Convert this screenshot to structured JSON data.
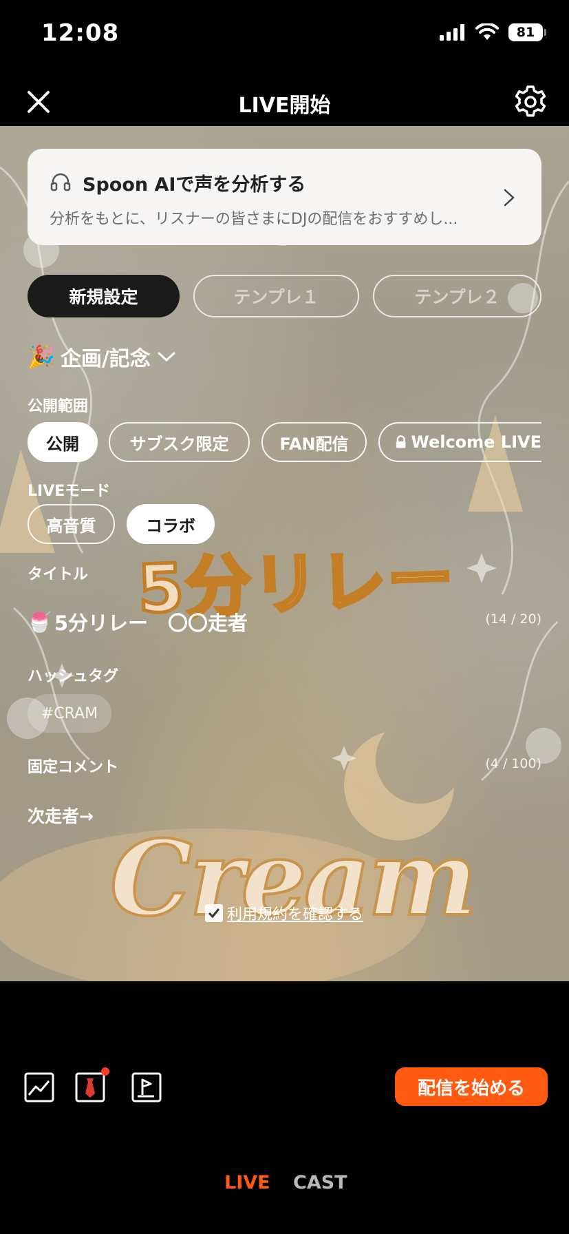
{
  "status_bar": {
    "time": "12:08",
    "battery": "81"
  },
  "header": {
    "title": "LIVE開始"
  },
  "ai_card": {
    "title": "Spoon AIで声を分析する",
    "description": "分析をもとに、リスナーの皆さまにDJの配信をおすすめし..."
  },
  "template_tabs": [
    "新規設定",
    "テンプレ１",
    "テンプレ２"
  ],
  "category": {
    "label": "企画/記念"
  },
  "visibility": {
    "label": "公開範囲",
    "options": [
      "公開",
      "サブスク限定",
      "FAN配信",
      "Welcome LIVE"
    ],
    "selected": "公開"
  },
  "live_mode": {
    "label": "LIVEモード",
    "options": [
      "高音質",
      "コラボ"
    ],
    "selected": "コラボ"
  },
  "title_section": {
    "label": "タイトル",
    "value": "5分リレー　〇〇走者",
    "counter": "(14 / 20)"
  },
  "hashtag_section": {
    "label": "ハッシュタグ",
    "tags": [
      "#CRAM"
    ]
  },
  "pinned_comment": {
    "label": "固定コメント",
    "value": "次走者→",
    "counter": "(4 / 100)"
  },
  "background_art": {
    "headline": "5分リレー",
    "script": "Cream"
  },
  "terms": {
    "label": "利用規約を確認する",
    "checked": true
  },
  "toolbar": {
    "icons": [
      "image-icon",
      "tie-icon",
      "music-icon"
    ],
    "start_label": "配信を始める"
  },
  "mode_tabs": {
    "live": "LIVE",
    "cast": "CAST",
    "active": "LIVE"
  },
  "colors": {
    "accent": "#ff5a0f",
    "notification_dot": "#ff3b30"
  }
}
